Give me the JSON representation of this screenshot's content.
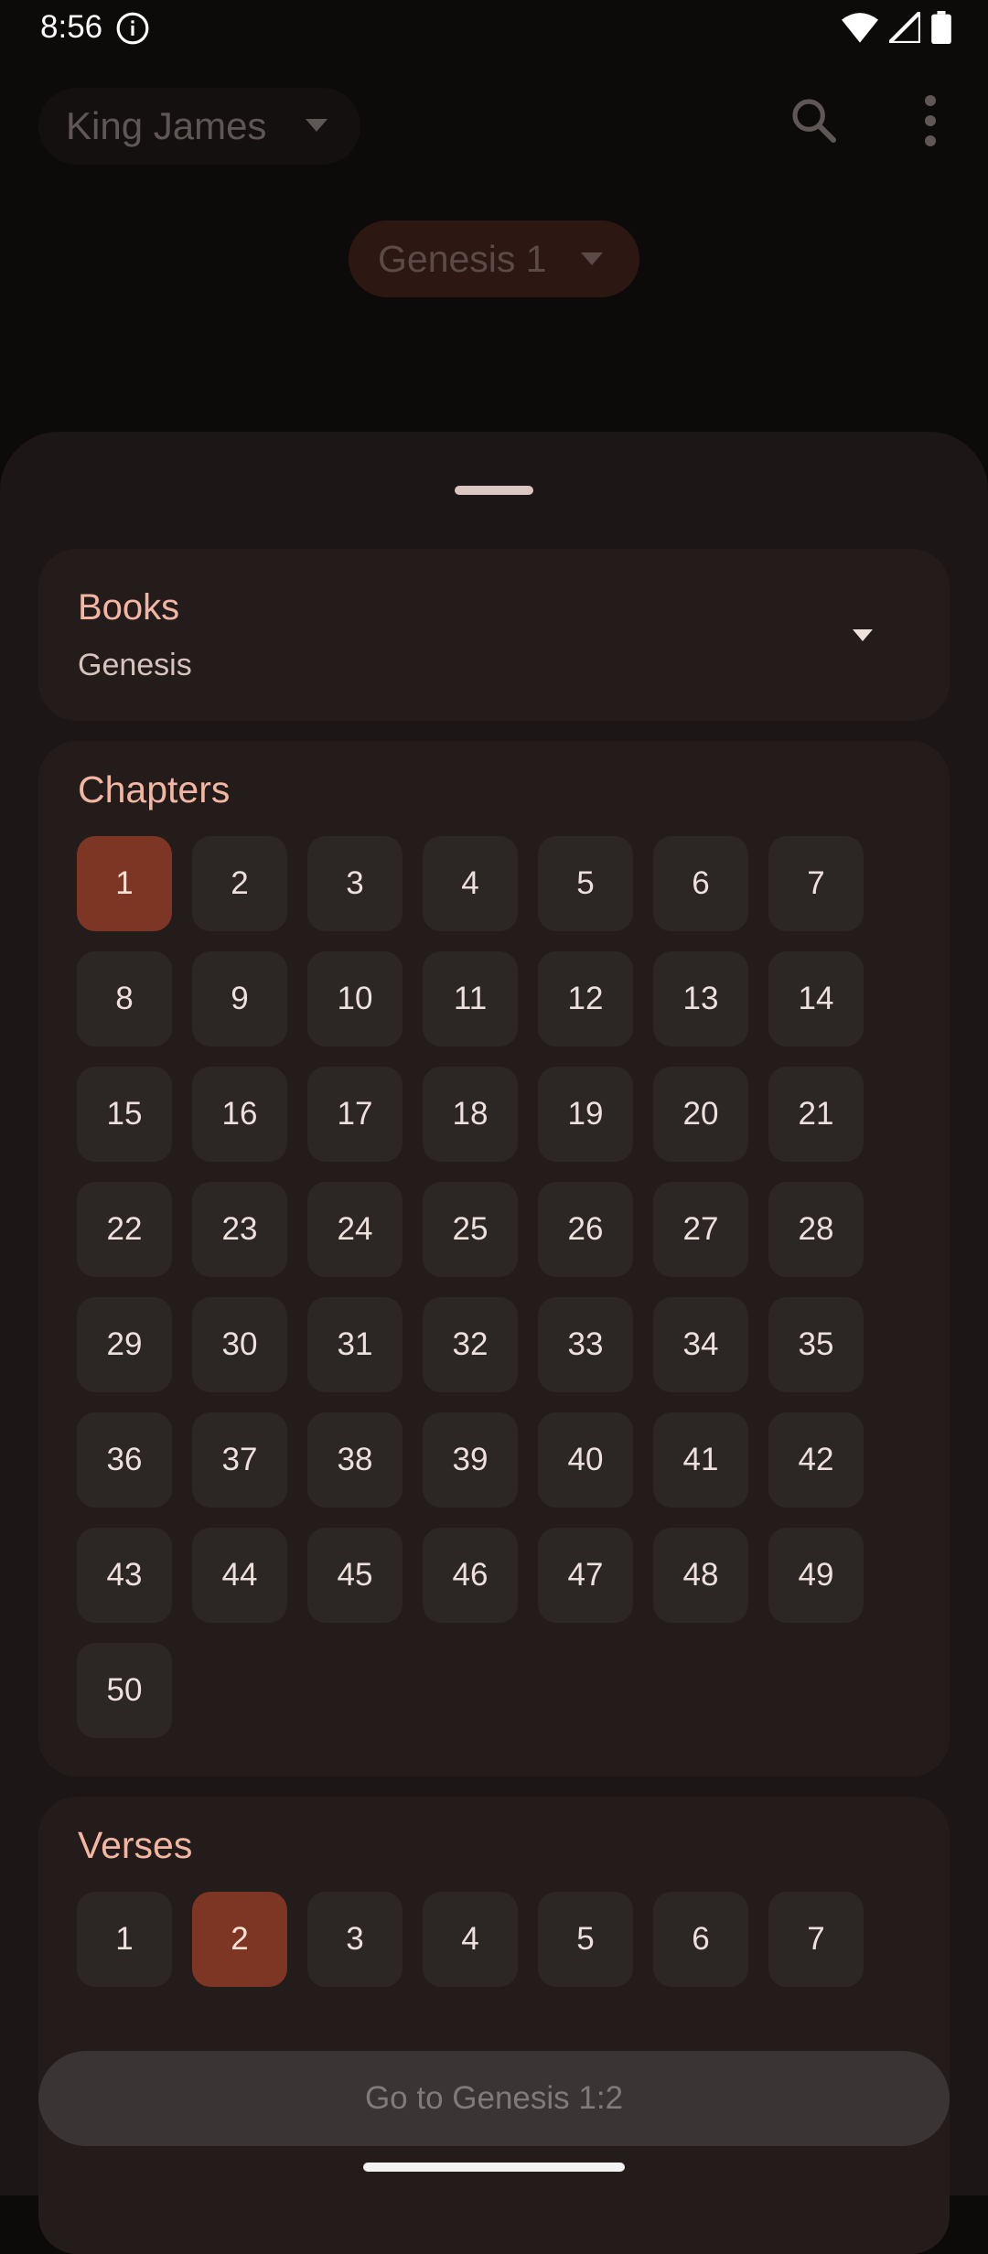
{
  "status": {
    "time": "8:56"
  },
  "header": {
    "version": "King James",
    "reference": "Genesis 1"
  },
  "books": {
    "title": "Books",
    "selected": "Genesis"
  },
  "chapters": {
    "title": "Chapters",
    "selected": 1,
    "items": [
      "1",
      "2",
      "3",
      "4",
      "5",
      "6",
      "7",
      "8",
      "9",
      "10",
      "11",
      "12",
      "13",
      "14",
      "15",
      "16",
      "17",
      "18",
      "19",
      "20",
      "21",
      "22",
      "23",
      "24",
      "25",
      "26",
      "27",
      "28",
      "29",
      "30",
      "31",
      "32",
      "33",
      "34",
      "35",
      "36",
      "37",
      "38",
      "39",
      "40",
      "41",
      "42",
      "43",
      "44",
      "45",
      "46",
      "47",
      "48",
      "49",
      "50"
    ]
  },
  "verses": {
    "title": "Verses",
    "selected": 2,
    "items": [
      "1",
      "2",
      "3",
      "4",
      "5",
      "6",
      "7"
    ]
  },
  "go_button": {
    "label": "Go to Genesis 1:2"
  },
  "colors": {
    "accent": "#7c3623",
    "title": "#f2b6a3",
    "sheet": "#1c1616"
  }
}
